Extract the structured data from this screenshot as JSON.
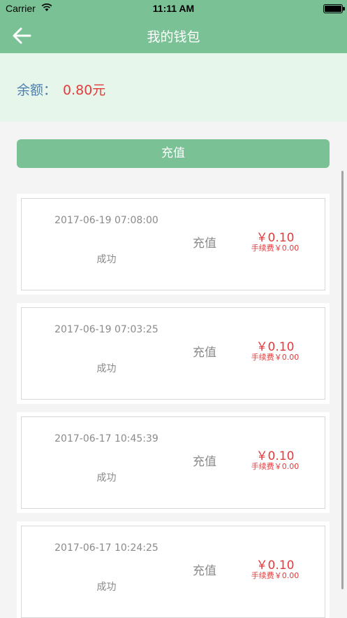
{
  "status_bar": {
    "carrier": "Carrier",
    "time": "11:11 AM"
  },
  "nav": {
    "title": "我的钱包"
  },
  "balance": {
    "label": "余额：",
    "amount": "0.80元"
  },
  "recharge_button": {
    "label": "充值"
  },
  "records": [
    {
      "datetime": "2017-06-19 07:08:00",
      "status": "成功",
      "type": "充值",
      "amount": "￥0.10",
      "fee": "手续费￥0.00"
    },
    {
      "datetime": "2017-06-19 07:03:25",
      "status": "成功",
      "type": "充值",
      "amount": "￥0.10",
      "fee": "手续费￥0.00"
    },
    {
      "datetime": "2017-06-17 10:45:39",
      "status": "成功",
      "type": "充值",
      "amount": "￥0.10",
      "fee": "手续费￥0.00"
    },
    {
      "datetime": "2017-06-17 10:24:25",
      "status": "成功",
      "type": "充值",
      "amount": "￥0.10",
      "fee": "手续费￥0.00"
    }
  ],
  "colors": {
    "brand": "#7ac295",
    "balance_bg": "#e7f6ea",
    "amount": "#e33b3b",
    "label": "#4d7fb1"
  }
}
